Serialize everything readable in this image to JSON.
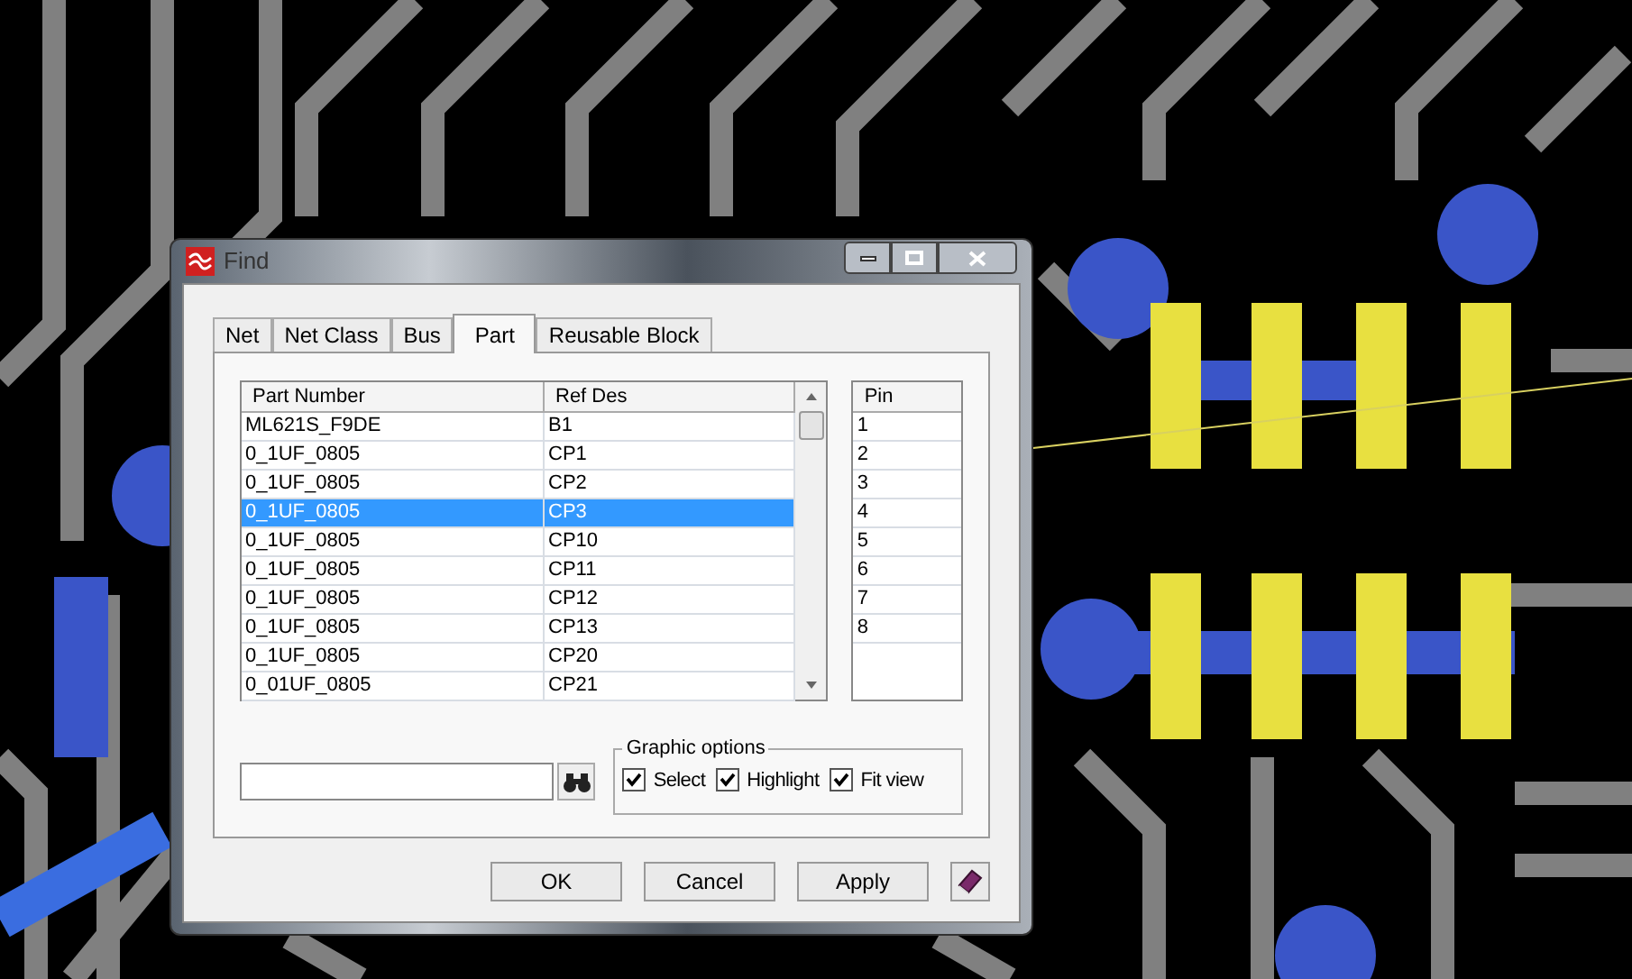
{
  "window": {
    "title": "Find"
  },
  "tabs": [
    {
      "label": "Net",
      "selected": false
    },
    {
      "label": "Net Class",
      "selected": false
    },
    {
      "label": "Bus",
      "selected": false
    },
    {
      "label": "Part",
      "selected": true
    },
    {
      "label": "Reusable Block",
      "selected": false
    }
  ],
  "table": {
    "columns": [
      "Part Number",
      "Ref Des"
    ],
    "rows": [
      {
        "cells": [
          "ML621S_F9DE",
          "B1"
        ],
        "selected": false
      },
      {
        "cells": [
          "0_1UF_0805",
          "CP1"
        ],
        "selected": false
      },
      {
        "cells": [
          "0_1UF_0805",
          "CP2"
        ],
        "selected": false
      },
      {
        "cells": [
          "0_1UF_0805",
          "CP3"
        ],
        "selected": true
      },
      {
        "cells": [
          "0_1UF_0805",
          "CP10"
        ],
        "selected": false
      },
      {
        "cells": [
          "0_1UF_0805",
          "CP11"
        ],
        "selected": false
      },
      {
        "cells": [
          "0_1UF_0805",
          "CP12"
        ],
        "selected": false
      },
      {
        "cells": [
          "0_1UF_0805",
          "CP13"
        ],
        "selected": false
      },
      {
        "cells": [
          "0_1UF_0805",
          "CP20"
        ],
        "selected": false
      },
      {
        "cells": [
          "0_01UF_0805",
          "CP21"
        ],
        "selected": false
      }
    ]
  },
  "pin_list": {
    "column": "Pin",
    "items": [
      "1",
      "2",
      "3",
      "4",
      "5",
      "6",
      "7",
      "8"
    ]
  },
  "graphic_options": {
    "title": "Graphic options",
    "options": [
      {
        "label": "Select",
        "checked": true
      },
      {
        "label": "Highlight",
        "checked": true
      },
      {
        "label": "Fit view",
        "checked": true
      }
    ]
  },
  "buttons": [
    "OK",
    "Cancel",
    "Apply"
  ]
}
